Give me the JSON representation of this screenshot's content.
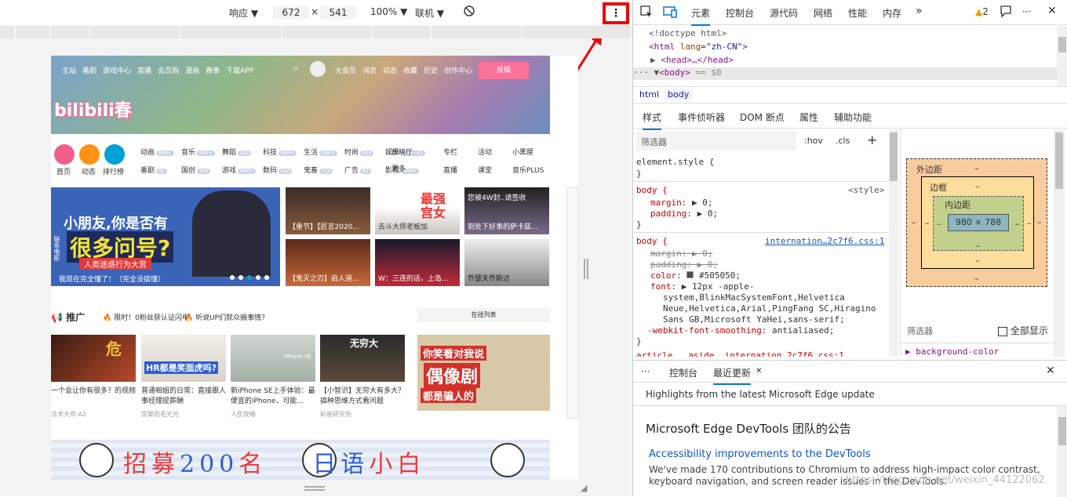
{
  "emulation": {
    "responsive_label": "响应 ▼",
    "width": "672",
    "times": "×",
    "height": "541",
    "zoom": "100% ▼",
    "throttle": "联机 ▼",
    "more_label": "⋮"
  },
  "site": {
    "nav": [
      "主站",
      "番剧",
      "游戏中心",
      "直播",
      "会员购",
      "漫画",
      "赛事",
      "下载APP"
    ],
    "nav_right": [
      "大会员",
      "消息",
      "动态",
      "收藏",
      "历史",
      "创作中心"
    ],
    "post_button": "投稿",
    "logo": "bilibili春",
    "quick": [
      "首页",
      "动态",
      "排行榜"
    ],
    "categories": [
      {
        "name": "动画",
        "badge": "999+"
      },
      {
        "name": "音乐",
        "badge": "999+"
      },
      {
        "name": "舞蹈",
        "badge": "542"
      },
      {
        "name": "科技",
        "badge": "999+"
      },
      {
        "name": "生活",
        "badge": "999+"
      },
      {
        "name": "时尚",
        "badge": "852"
      },
      {
        "name": "娱乐",
        "badge": "999+"
      },
      {
        "name": "番剧",
        "badge": "81"
      },
      {
        "name": "国创",
        "badge": "108"
      },
      {
        "name": "游戏",
        "badge": "999+"
      },
      {
        "name": "数码",
        "badge": "544"
      },
      {
        "name": "鬼畜",
        "badge": "114"
      },
      {
        "name": "广告",
        "badge": "80"
      },
      {
        "name": "影视",
        "badge": "999+"
      }
    ],
    "cat_extra": [
      "放映厅",
      "更多"
    ],
    "cat_extra_badge": "41",
    "extras": [
      "专栏",
      "活动",
      "小黑屋",
      "直播",
      "课堂",
      "音乐PLUS"
    ],
    "carousel": {
      "line1": "小朋友,你是否有",
      "line2": "很多问号?",
      "line3": "人类迷惑行为大赏",
      "caption": "我现在完全懂了！（完全没搞懂）",
      "side": "联系电影"
    },
    "thumbs": [
      {
        "cap": "【重节】【匠言2020..."
      },
      {
        "cap": "去斗大师老板加",
        "overlay": "最强宫女"
      },
      {
        "cap": "到处下好事的萨卡兹...",
        "overlay": "您被4W封..请签收"
      },
      {
        "cap": "【鬼灭之刃】启人道..."
      },
      {
        "cap": "W：三连的话，上岛..."
      },
      {
        "cap": "乔瑟夫乔斯达"
      }
    ],
    "promo_label": "推广",
    "promo_items": [
      "限时！0粉丝获认证闪电",
      "听说UP们就众摘事情？"
    ],
    "online_list": "在线列表",
    "cards": [
      {
        "title": "一个会让你有很多？的视频",
        "up": "法术大师·A2",
        "overlay": "危"
      },
      {
        "title": "普通相姐的日常：直接跟人事经理提薪酬",
        "up": "宗翠的毛光光",
        "overlay": "HR都是笑面虎吗?"
      },
      {
        "title": "新iPhone SE上手体验：最便宜的iPhone，可能...",
        "up": "人民攻略",
        "overlay": "iPhone SE"
      },
      {
        "title": "【小智识】无穷大有多大？搞种思维方式看问题",
        "up": "彩爸研究所",
        "overlay": "无穷大"
      }
    ],
    "bigad": {
      "line1": "你笑看对我说",
      "line2": "偶像剧",
      "line3": "都是骗人的"
    },
    "recruit": {
      "a": "招募",
      "b": "200",
      "c": "名",
      "d": "日语",
      "e": "小白"
    }
  },
  "devtools": {
    "tabs": [
      "元素",
      "控制台",
      "源代码",
      "网络",
      "性能",
      "内存"
    ],
    "more_tabs": "»",
    "warnings": "2",
    "dom": {
      "doctype": "<!doctype html>",
      "html_open": "<html",
      "lang_attr": "lang",
      "lang_val": "\"zh-CN\"",
      "head": "<head>…</head>",
      "body": "<body>",
      "body_eq": "== $0"
    },
    "crumbs": [
      "html",
      "body"
    ],
    "subtabs": [
      "样式",
      "事件侦听器",
      "DOM 断点",
      "属性",
      "辅助功能"
    ],
    "filter_placeholder": "筛选器",
    "hov": ":hov",
    "cls": ".cls",
    "plus": "+",
    "element_style": "element.style {",
    "close_brace": "}",
    "rule1": {
      "selector": "body {",
      "source": "<style>",
      "p1": "margin",
      "v1": "▶ 0;",
      "p2": "padding",
      "v2": "▶ 0;"
    },
    "rule2": {
      "selector": "body {",
      "source": "internation…2c7f6.css:1",
      "margin": "margin: ▶ 0;",
      "padding": "padding: ▶ 0;",
      "color_p": "color",
      "color_v": "#505050;",
      "font_p": "font",
      "font_v1": "▶ 12px -apple-",
      "font_v2": "system,BlinkMacSystemFont,Helvetica",
      "font_v3": "Neue,Helvetica,Arial,PingFang SC,Hiragino",
      "font_v4": "Sans GB,Microsoft YaHei,sans-serif;",
      "smoothing_p": "-webkit-font-smoothing",
      "smoothing_v": "antialiased;"
    },
    "next_rule": "article, .aside,      internation…2c7f6.css:1",
    "box": {
      "margin": "外边距",
      "border": "边框",
      "padding": "内边距",
      "content": "980 × 788",
      "dash": "–"
    },
    "computed_filter": "筛选器",
    "show_all": "全部显示",
    "computed_first": "background-color",
    "drawer": {
      "tabs": [
        "控制台",
        "最近更新"
      ],
      "highlight": "Highlights from the latest Microsoft Edge update",
      "heading": "Microsoft Edge DevTools 团队的公告",
      "article_title": "Accessibility improvements to the DevTools",
      "article_text": "We've made 170 contributions to Chromium to address high-impact color contrast, keyboard navigation, and screen reader issues in the DevTools."
    },
    "watermark": "https://blog.csdn.net/weixin_44122062"
  },
  "colors": {
    "accent": "#0078d4",
    "bili_pink": "#fb7299",
    "highlight_red": "#e00000"
  }
}
